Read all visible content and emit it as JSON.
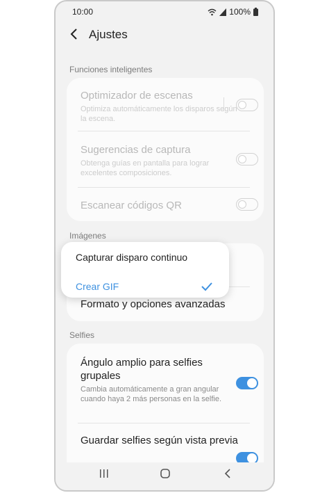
{
  "status_bar": {
    "time": "10:00",
    "battery": "100%"
  },
  "header": {
    "title": "Ajustes"
  },
  "sections": {
    "smart": {
      "label": "Funciones inteligentes",
      "items": [
        {
          "title": "Optimizador de escenas",
          "subtitle": "Optimiza automáticamente los disparos según la escena.",
          "enabled": false,
          "on": false
        },
        {
          "title": "Sugerencias de captura",
          "subtitle": "Obtenga guías en pantalla para lograr excelentes composiciones.",
          "enabled": false,
          "on": false
        },
        {
          "title": "Escanear códigos QR",
          "enabled": false,
          "on": false
        }
      ]
    },
    "images": {
      "label": "Imágenes",
      "items": [
        {
          "title": "Formato y opciones avanzadas"
        }
      ]
    },
    "selfies": {
      "label": "Selfies",
      "items": [
        {
          "title": "Ángulo amplio para selfies grupales",
          "subtitle": "Cambia automáticamente a gran angular cuando haya 2 más personas en la selfie.",
          "on": true
        },
        {
          "title": "Guardar selfies según vista previa",
          "on": true
        }
      ]
    }
  },
  "popup": {
    "options": [
      {
        "label": "Capturar disparo continuo",
        "selected": false
      },
      {
        "label": "Crear GIF",
        "selected": true
      }
    ]
  },
  "colors": {
    "accent": "#3e91e0",
    "background": "#f2f2f2",
    "card": "#fbfbfb"
  },
  "icons": {
    "back": "chevron-left-icon",
    "check": "check-icon",
    "wifi": "wifi-icon",
    "signal": "signal-icon",
    "battery": "battery-icon"
  }
}
